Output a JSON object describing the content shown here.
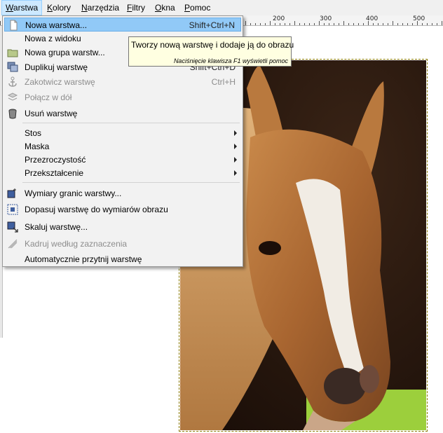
{
  "menubar": {
    "items": [
      "Warstwa",
      "Kolory",
      "Narzędzia",
      "Filtry",
      "Okna",
      "Pomoc"
    ]
  },
  "ruler": {
    "labels": [
      "200",
      "300",
      "400",
      "500"
    ]
  },
  "menu": {
    "items": [
      {
        "label": "Nowa warstwa...",
        "accel": "Shift+Ctrl+N",
        "icon": "new-layer-icon"
      },
      {
        "label": "Nowa z widoku",
        "accel": "",
        "icon": ""
      },
      {
        "label": "Nowa grupa warstw...",
        "accel": "",
        "icon": "folder-icon"
      },
      {
        "label": "Duplikuj warstwę",
        "accel": "Shift+Ctrl+D",
        "icon": "duplicate-icon"
      },
      {
        "label": "Zakotwicz warstwę",
        "accel": "Ctrl+H",
        "icon": "anchor-icon"
      },
      {
        "label": "Połącz w dół",
        "accel": "",
        "icon": "merge-down-icon"
      },
      {
        "label": "Usuń warstwę",
        "accel": "",
        "icon": "trash-icon"
      },
      {
        "label": "Stos",
        "accel": "",
        "icon": ""
      },
      {
        "label": "Maska",
        "accel": "",
        "icon": ""
      },
      {
        "label": "Przezroczystość",
        "accel": "",
        "icon": ""
      },
      {
        "label": "Przekształcenie",
        "accel": "",
        "icon": ""
      },
      {
        "label": "Wymiary granic warstwy...",
        "accel": "",
        "icon": "boundary-size-icon"
      },
      {
        "label": "Dopasuj warstwę do wymiarów obrazu",
        "accel": "",
        "icon": "fit-to-image-icon"
      },
      {
        "label": "Skaluj warstwę...",
        "accel": "",
        "icon": "scale-icon"
      },
      {
        "label": "Kadruj według zaznaczenia",
        "accel": "",
        "icon": "crop-icon"
      },
      {
        "label": "Automatycznie przytnij warstwę",
        "accel": "",
        "icon": ""
      }
    ]
  },
  "tooltip": {
    "main": "Tworzy nową warstwę i dodaje ją do obrazu",
    "hint": "Naciśnięcie klawisza F1 wyświetli pomoc"
  },
  "colors": {
    "highlight": "#91c9f7",
    "tooltip_bg": "#ffffe1",
    "menu_bg": "#f2f2f2"
  }
}
